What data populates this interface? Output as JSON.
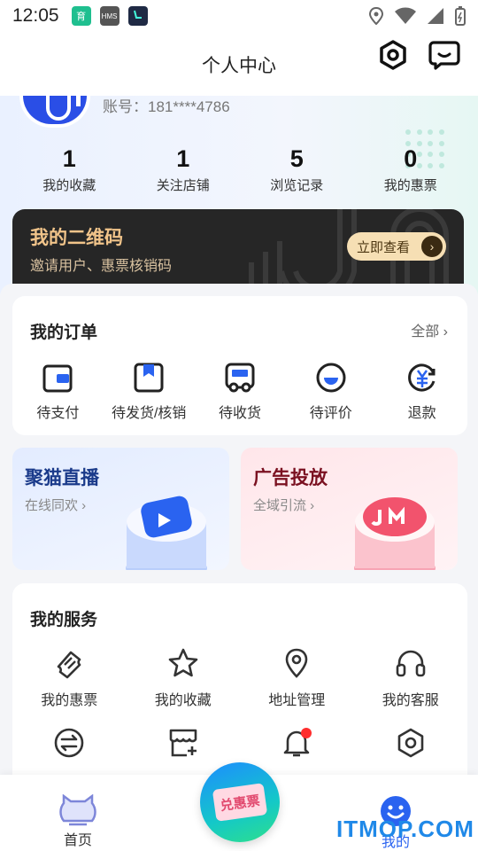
{
  "status_bar": {
    "time": "12:05",
    "notif_icons": [
      "app-badge-icon",
      "hms-icon",
      "app-icon"
    ],
    "right_icons": [
      "location-icon",
      "wifi-icon",
      "signal-icon",
      "battery-icon"
    ],
    "notif_labels": [
      "育",
      "HMS"
    ]
  },
  "header": {
    "title": "个人中心"
  },
  "profile": {
    "account": "账号：181****4786"
  },
  "stats": [
    {
      "num": "1",
      "label": "我的收藏"
    },
    {
      "num": "1",
      "label": "关注店铺"
    },
    {
      "num": "5",
      "label": "浏览记录"
    },
    {
      "num": "0",
      "label": "我的惠票"
    }
  ],
  "qr_card": {
    "title": "我的二维码",
    "subtitle": "邀请用户、惠票核销码",
    "button": "立即查看"
  },
  "orders": {
    "title": "我的订单",
    "more": "全部",
    "items": [
      {
        "label": "待支付",
        "icon": "wallet-icon"
      },
      {
        "label": "待发货/核销",
        "icon": "bookmark-icon"
      },
      {
        "label": "待收货",
        "icon": "truck-icon"
      },
      {
        "label": "待评价",
        "icon": "comment-icon"
      },
      {
        "label": "退款",
        "icon": "yen-icon"
      }
    ]
  },
  "promos": [
    {
      "title": "聚猫直播",
      "subtitle": "在线同欢",
      "color": "#1a3a8a"
    },
    {
      "title": "广告投放",
      "subtitle": "全域引流",
      "color": "#7a1020"
    }
  ],
  "services": {
    "title": "我的服务",
    "items": [
      {
        "label": "我的惠票",
        "icon": "ticket-icon"
      },
      {
        "label": "我的收藏",
        "icon": "star-icon"
      },
      {
        "label": "地址管理",
        "icon": "location-pin-icon"
      },
      {
        "label": "我的客服",
        "icon": "headset-icon"
      },
      {
        "label": "",
        "icon": "exchange-icon"
      },
      {
        "label": "",
        "icon": "store-add-icon"
      },
      {
        "label": "",
        "icon": "bell-icon"
      },
      {
        "label": "",
        "icon": "settings-icon"
      }
    ]
  },
  "tabbar": {
    "home": "首页",
    "center": "兑惠票",
    "mine": "我的",
    "watermark": "ITMOP.COM"
  },
  "colors": {
    "accent": "#2a4ee6",
    "gold": "#f1c48a",
    "dark_card": "#262626",
    "tab_active": "#2089e8"
  }
}
